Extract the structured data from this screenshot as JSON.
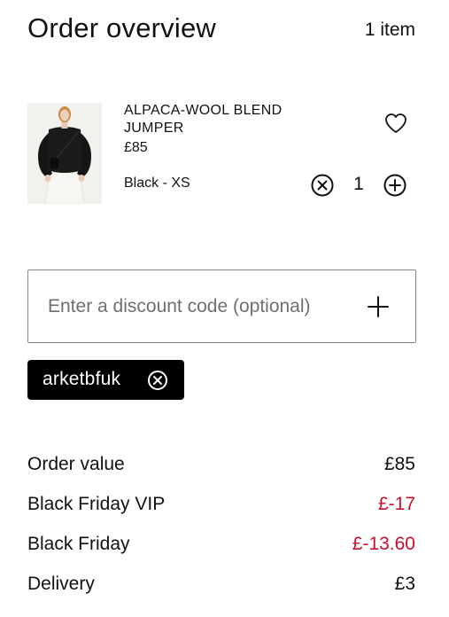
{
  "header": {
    "title": "Order overview",
    "item_count": "1 item"
  },
  "product": {
    "name": "ALPACA-WOOL BLEND JUMPER",
    "price": "£85",
    "variant": "Black - XS",
    "quantity": "1",
    "icons": {
      "wishlist": "heart-icon",
      "decrease": "circle-x-icon",
      "increase": "circle-plus-icon"
    }
  },
  "discount": {
    "placeholder": "Enter a discount code (optional)",
    "value": "",
    "add_icon": "plus-icon"
  },
  "applied_code": {
    "label": "arketbfuk",
    "remove_icon": "circle-x-icon"
  },
  "summary": {
    "rows": [
      {
        "label": "Order value",
        "value": "£85"
      },
      {
        "label": "Black Friday VIP",
        "value": "£-17"
      },
      {
        "label": "Black Friday",
        "value": "£-13.60"
      },
      {
        "label": "Delivery",
        "value": "£3"
      }
    ]
  },
  "colors": {
    "text": "#111111",
    "discount_red": "#c8102e",
    "chip_bg": "#000000",
    "border": "#8a8a8a"
  }
}
